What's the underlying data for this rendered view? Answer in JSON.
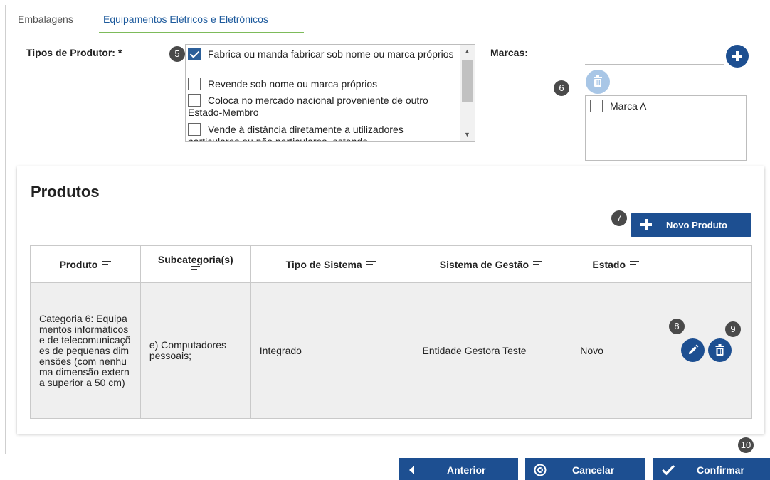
{
  "tabs": [
    {
      "label": "Embalagens",
      "active": false
    },
    {
      "label": "Equipamentos Elétricos e Eletrónicos",
      "active": true
    }
  ],
  "tipos_produtor": {
    "label": "Tipos de Produtor: *",
    "options": [
      {
        "label": "Fabrica ou manda fabricar sob nome ou marca próprios",
        "checked": true
      },
      {
        "label": "Revende sob nome ou marca próprios",
        "checked": false
      },
      {
        "label": "Coloca no mercado nacional proveniente de outro Estado-Membro",
        "checked": false
      },
      {
        "label": "Vende à distância diretamente a utilizadores particulares ou não particulares, estando",
        "checked": false
      }
    ]
  },
  "marcas": {
    "label": "Marcas:",
    "items": [
      {
        "label": "Marca A",
        "checked": false
      }
    ]
  },
  "produtos": {
    "title": "Produtos",
    "novo_label": "Novo Produto",
    "columns": [
      "Produto",
      "Subcategoria(s)",
      "Tipo de Sistema",
      "Sistema de Gestão",
      "Estado"
    ],
    "rows": [
      {
        "produto": "Categoria 6: Equipamentos informáticos e de telecomunicações de pequenas dimensões (com nenhuma dimensão externa superior a 50 cm)",
        "subcategoria": "e) Computadores pessoais;",
        "tipo_sistema": "Integrado",
        "sistema_gestao": "Entidade Gestora Teste",
        "estado": "Novo"
      }
    ]
  },
  "footer": {
    "anterior": "Anterior",
    "cancelar": "Cancelar",
    "confirmar": "Confirmar"
  },
  "badges": {
    "b5": "5",
    "b6": "6",
    "b7": "7",
    "b8": "8",
    "b9": "9",
    "b10": "10"
  },
  "colors": {
    "primary": "#1d4f91",
    "tab_accent": "#7dbb5a",
    "badge": "#4a4a4a",
    "row_bg": "#efefef"
  }
}
